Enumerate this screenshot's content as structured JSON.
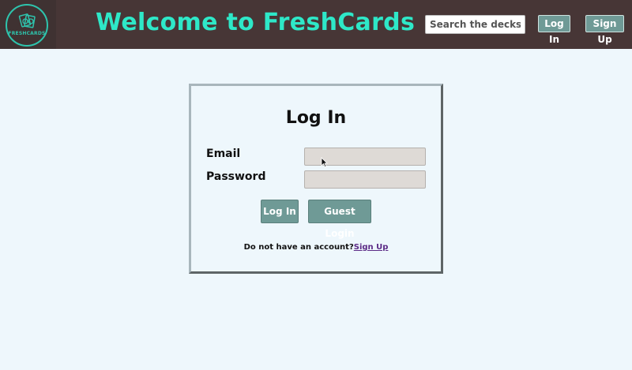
{
  "navbar": {
    "logo_text": "FRESHCARDS",
    "title": "Welcome to FreshCards",
    "search_placeholder": "Search the decks",
    "login_label": "Log In",
    "signup_label": "Sign Up"
  },
  "login_form": {
    "title": "Log In",
    "email_label": "Email",
    "email_value": "",
    "password_label": "Password",
    "password_value": "",
    "login_button": "Log In",
    "guest_button": "Guest Login",
    "no_account_text": "Do not have an account?",
    "signup_link": "Sign Up"
  },
  "colors": {
    "navbar_bg": "#473636",
    "title_accent": "#2ee8c8",
    "button_bg": "#6f9a96",
    "page_bg": "#eef7fc",
    "input_bg": "#dedad6",
    "link": "#5b2a86"
  },
  "icons": {
    "logo": "freshcards-logo-icon",
    "cursor": "mouse-pointer-icon"
  }
}
